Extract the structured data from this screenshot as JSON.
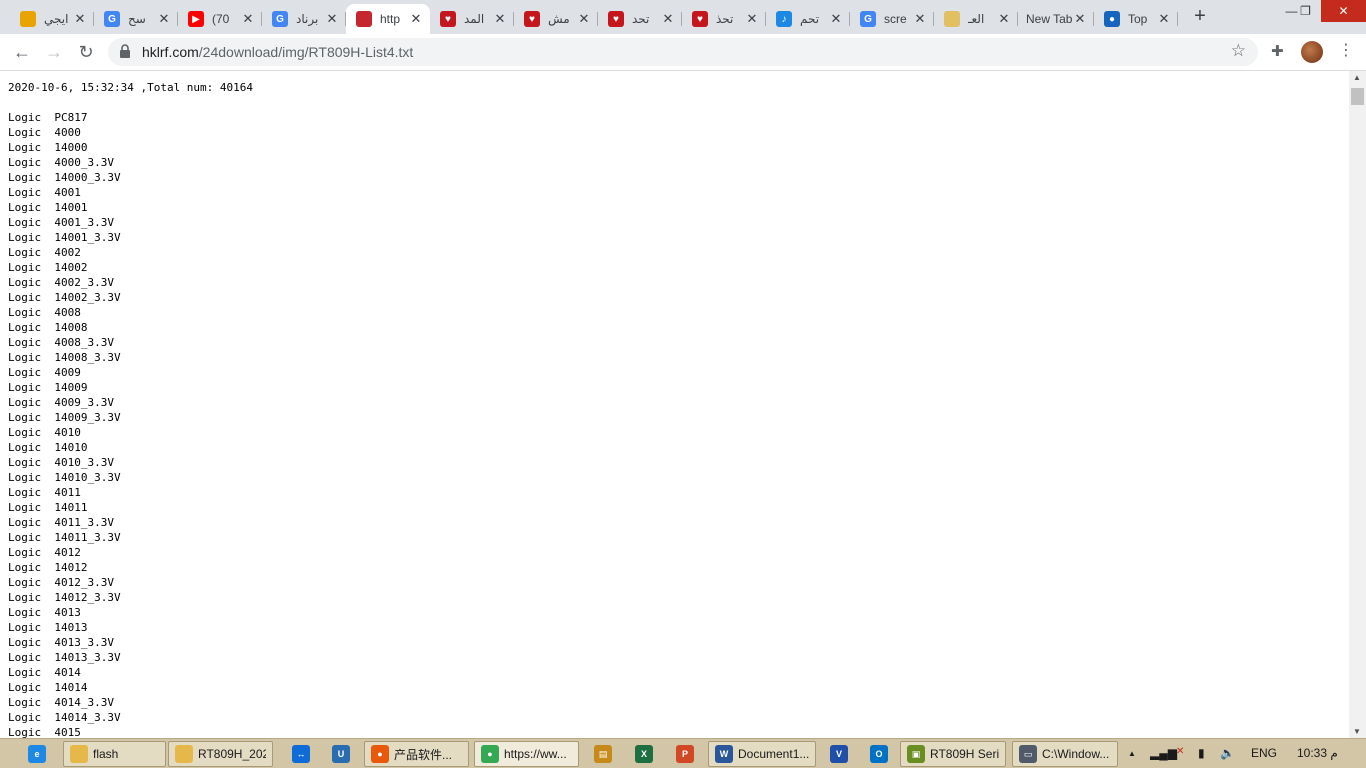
{
  "browser": {
    "tabs": [
      {
        "title": "ايجي",
        "favicon": "egybest-icon",
        "color": "#e8a400",
        "badge": ""
      },
      {
        "title": "سح",
        "favicon": "google-icon",
        "color": "#4285f4",
        "badge": "G"
      },
      {
        "title": "(70",
        "favicon": "youtube-icon",
        "color": "#ff0000",
        "badge": "▶"
      },
      {
        "title": "برناد",
        "favicon": "google-icon",
        "color": "#4285f4",
        "badge": "G"
      },
      {
        "title": "http",
        "favicon": "site-icon",
        "color": "#c6262e",
        "badge": "",
        "active": true
      },
      {
        "title": "المد",
        "favicon": "heart-icon",
        "color": "#c4161c",
        "badge": "♥"
      },
      {
        "title": "مش",
        "favicon": "heart-icon",
        "color": "#c4161c",
        "badge": "♥"
      },
      {
        "title": "تحد",
        "favicon": "heart-icon",
        "color": "#c4161c",
        "badge": "♥"
      },
      {
        "title": "تحذ",
        "favicon": "heart-icon",
        "color": "#c4161c",
        "badge": "♥"
      },
      {
        "title": "تحم",
        "favicon": "music-icon",
        "color": "#1e88e5",
        "badge": "♪"
      },
      {
        "title": "scre",
        "favicon": "google-icon",
        "color": "#4285f4",
        "badge": "G"
      },
      {
        "title": "العـ",
        "favicon": "folder-icon",
        "color": "#e0c060",
        "badge": ""
      },
      {
        "title": "New Tab",
        "favicon": "",
        "color": "",
        "badge": ""
      },
      {
        "title": "Top",
        "favicon": "globe-icon",
        "color": "#1565c0",
        "badge": "●"
      }
    ],
    "new_tab": "+",
    "window_controls": {
      "minimize": "—",
      "maximize": "❐",
      "close": "✕"
    },
    "nav": {
      "back": "←",
      "forward": "→",
      "reload": "↻",
      "star": "☆",
      "extensions": "✚",
      "menu": "⋮"
    },
    "address": {
      "domain": "hklrf.com",
      "path": "/24download/img/RT809H-List4.txt"
    }
  },
  "document": {
    "header": "2020-10-6, 15:32:34 ,Total num: 40164",
    "lines": [
      "Logic  PC817",
      "Logic  4000",
      "Logic  14000",
      "Logic  4000_3.3V",
      "Logic  14000_3.3V",
      "Logic  4001",
      "Logic  14001",
      "Logic  4001_3.3V",
      "Logic  14001_3.3V",
      "Logic  4002",
      "Logic  14002",
      "Logic  4002_3.3V",
      "Logic  14002_3.3V",
      "Logic  4008",
      "Logic  14008",
      "Logic  4008_3.3V",
      "Logic  14008_3.3V",
      "Logic  4009",
      "Logic  14009",
      "Logic  4009_3.3V",
      "Logic  14009_3.3V",
      "Logic  4010",
      "Logic  14010",
      "Logic  4010_3.3V",
      "Logic  14010_3.3V",
      "Logic  4011",
      "Logic  14011",
      "Logic  4011_3.3V",
      "Logic  14011_3.3V",
      "Logic  4012",
      "Logic  14012",
      "Logic  4012_3.3V",
      "Logic  14012_3.3V",
      "Logic  4013",
      "Logic  14013",
      "Logic  4013_3.3V",
      "Logic  14013_3.3V",
      "Logic  4014",
      "Logic  14014",
      "Logic  4014_3.3V",
      "Logic  14014_3.3V",
      "Logic  4015"
    ]
  },
  "taskbar": {
    "items": [
      {
        "label": "",
        "icon": "ie-icon",
        "color": "#1e88e5",
        "badge": "e",
        "kind": "pin"
      },
      {
        "label": "flash",
        "icon": "folder-icon",
        "color": "#e6b84a",
        "badge": "",
        "kind": "win"
      },
      {
        "label": "RT809H_202...",
        "icon": "folder-icon",
        "color": "#e6b84a",
        "badge": "",
        "kind": "win"
      },
      {
        "label": "",
        "icon": "teamviewer-icon",
        "color": "#0e6bd8",
        "badge": "↔",
        "kind": "pin"
      },
      {
        "label": "",
        "icon": "tool-icon",
        "color": "#2a6cb0",
        "badge": "U",
        "kind": "pin"
      },
      {
        "label": "产品软件...",
        "icon": "firefox-icon",
        "color": "#e8590c",
        "badge": "●",
        "kind": "win"
      },
      {
        "label": "https://ww...",
        "icon": "chrome-icon",
        "color": "#34a853",
        "badge": "●",
        "kind": "win",
        "active": true
      },
      {
        "label": "",
        "icon": "archive-icon",
        "color": "#c58a1a",
        "badge": "▤",
        "kind": "pin"
      },
      {
        "label": "",
        "icon": "excel-icon",
        "color": "#1d6f42",
        "badge": "X",
        "kind": "pin"
      },
      {
        "label": "",
        "icon": "powerpoint-icon",
        "color": "#d24726",
        "badge": "P",
        "kind": "pin"
      },
      {
        "label": "Document1...",
        "icon": "word-icon",
        "color": "#2b579a",
        "badge": "W",
        "kind": "win"
      },
      {
        "label": "",
        "icon": "vpn-icon",
        "color": "#1f4fa8",
        "badge": "V",
        "kind": "pin"
      },
      {
        "label": "",
        "icon": "outlook-icon",
        "color": "#0072c6",
        "badge": "O",
        "kind": "pin"
      },
      {
        "label": "RT809H Seri...",
        "icon": "programmer-icon",
        "color": "#6b8e23",
        "badge": "▣",
        "kind": "win"
      },
      {
        "label": "C:\\Window...",
        "icon": "console-icon",
        "color": "#505a6b",
        "badge": "▭",
        "kind": "win"
      }
    ],
    "tray": {
      "chevron": "▲",
      "signal": "▂▄▆",
      "battery": "▮",
      "volume": "🔈",
      "lang": "ENG",
      "time": "10:33 م"
    }
  }
}
